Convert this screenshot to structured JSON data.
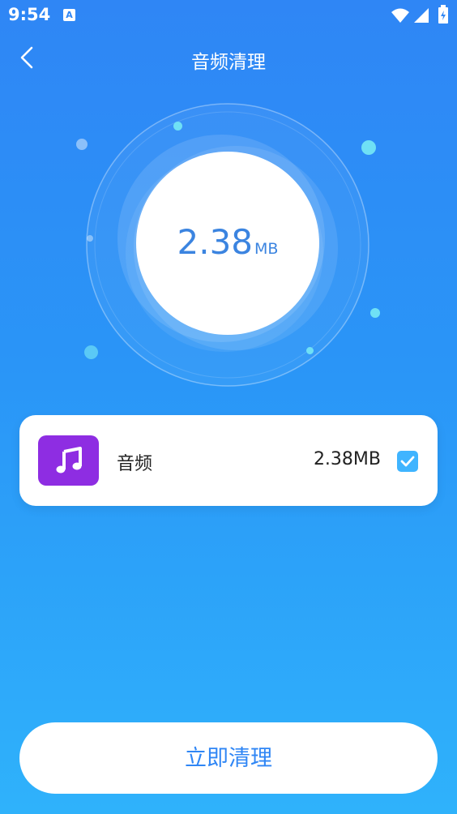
{
  "status_bar": {
    "time": "9:54",
    "notification_icon": "a-icon",
    "icons": [
      "wifi-icon",
      "signal-icon",
      "battery-icon"
    ]
  },
  "toolbar": {
    "back_icon": "chevron-left-icon",
    "title": "音频清理"
  },
  "summary": {
    "size_value": "2.38",
    "size_unit": "MB"
  },
  "file_list": [
    {
      "icon": "music-note-icon",
      "name": "音频",
      "size": "2.38MB",
      "checked": true
    }
  ],
  "action": {
    "clean_label": "立即清理"
  },
  "colors": {
    "bg_top": "#2f86f5",
    "bg_bottom": "#2fb2fb",
    "accent": "#3b84e0",
    "audio_tile": "#8e2de2",
    "checkbox": "#3fb4ff"
  }
}
